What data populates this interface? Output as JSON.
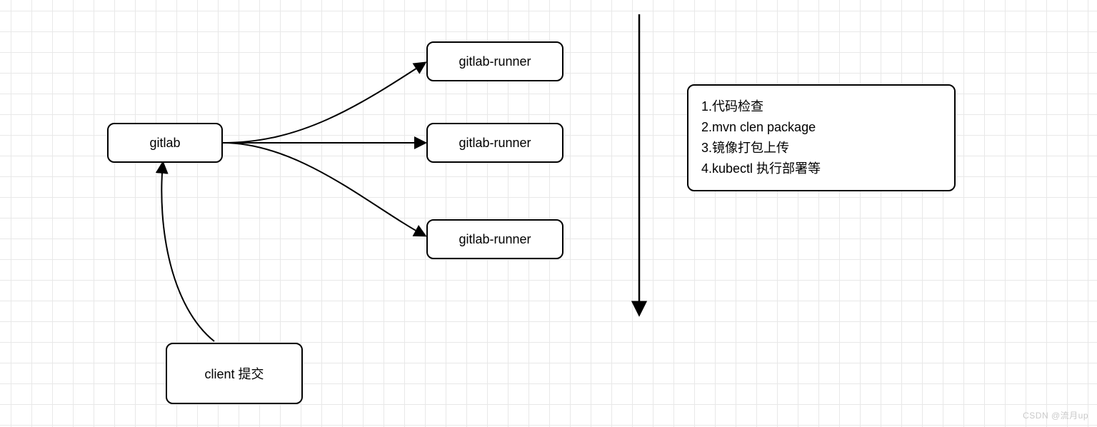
{
  "nodes": {
    "gitlab": "gitlab",
    "runner1": "gitlab-runner",
    "runner2": "gitlab-runner",
    "runner3": "gitlab-runner",
    "client": "client 提交"
  },
  "steps": {
    "s1": "1.代码检查",
    "s2": "2.mvn clen package",
    "s3": "3.镜像打包上传",
    "s4": "4.kubectl 执行部署等"
  },
  "watermark": "CSDN @流月up"
}
